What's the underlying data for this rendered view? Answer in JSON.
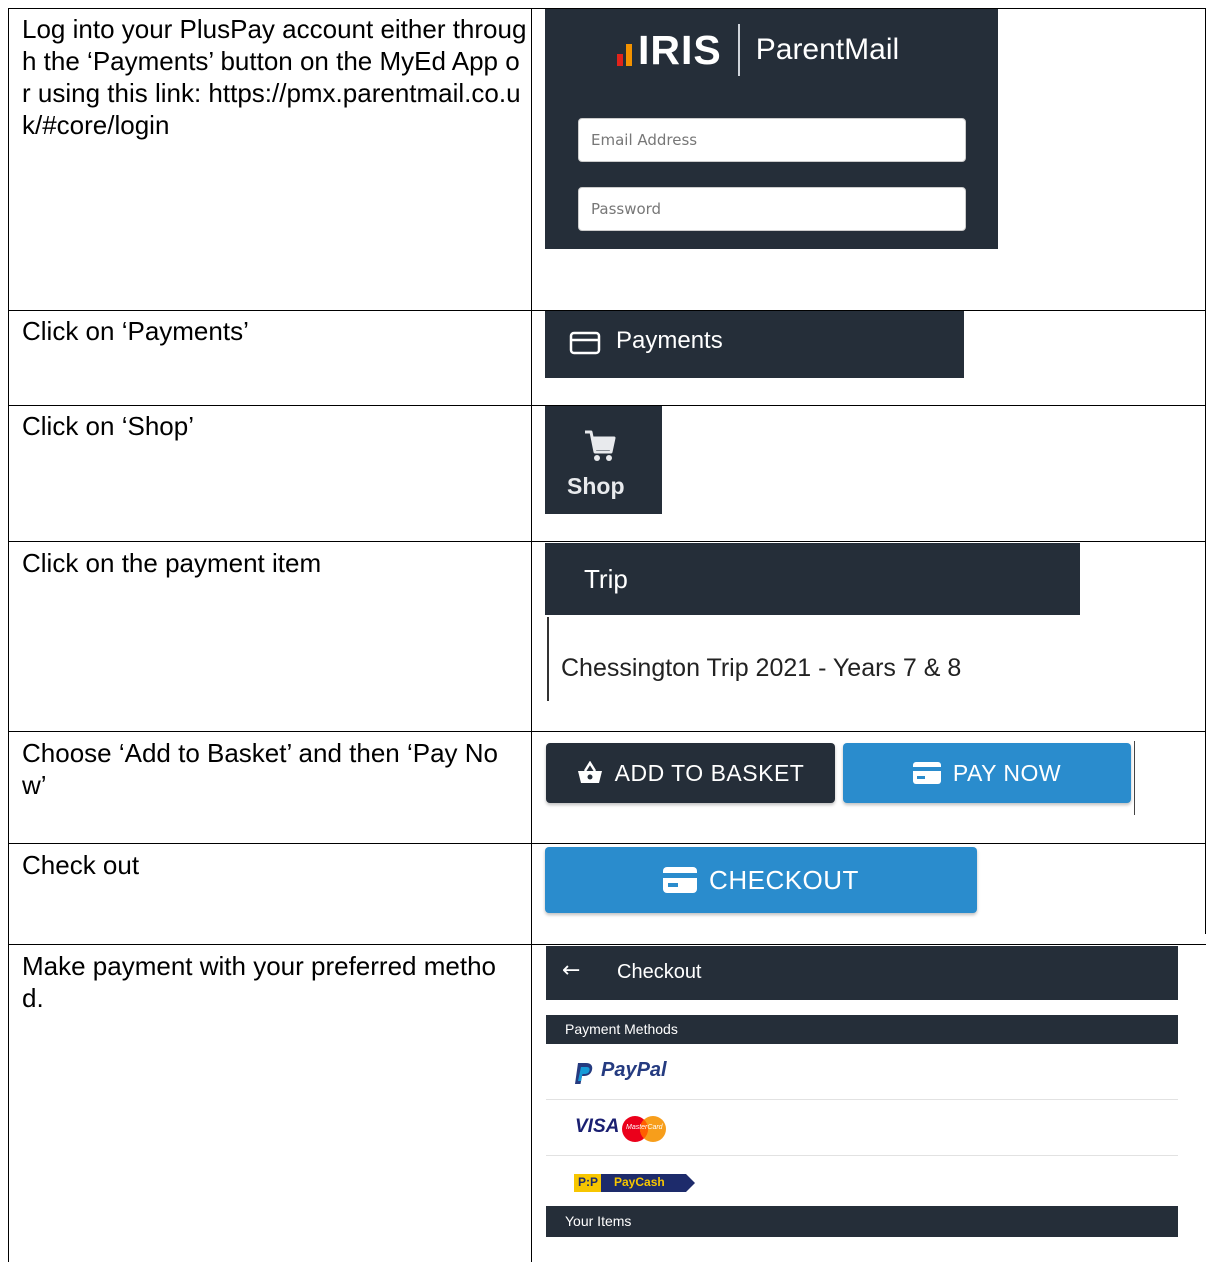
{
  "rows": [
    {
      "description": "Log into your PlusPay account either through the ‘Payments’ button on the MyEd App or using this link: https://pmx.parentmail.co.uk/#core/login"
    },
    {
      "description": "Click on ‘Payments’"
    },
    {
      "description": "Click on ‘Shop’"
    },
    {
      "description": "Click on the payment item"
    },
    {
      "description": "Choose ‘Add to Basket’ and then ‘Pay Now’"
    },
    {
      "description": "Check out"
    },
    {
      "description": "Make payment with your preferred method."
    }
  ],
  "login": {
    "logo_brand": "IRIS",
    "logo_product": "ParentMail",
    "email_placeholder": "Email Address",
    "password_placeholder": "Password"
  },
  "payments_button": {
    "label": "Payments",
    "icon": "card-icon"
  },
  "shop_button": {
    "label": "Shop",
    "icon": "cart-icon"
  },
  "trip": {
    "header": "Trip",
    "item": "Chessington Trip 2021 - Years 7 & 8"
  },
  "buttons": {
    "add_to_basket": "ADD TO BASKET",
    "pay_now": "PAY NOW",
    "checkout": "CHECKOUT"
  },
  "checkout_panel": {
    "back_icon": "←",
    "title": "Checkout",
    "payment_methods_heading": "Payment Methods",
    "methods": [
      {
        "name": "PayPal",
        "logo": "paypal-logo"
      },
      {
        "name": "VISA",
        "logo": "visa-mastercard-logo",
        "secondary": "MasterCard"
      },
      {
        "name": "PayCash",
        "logo": "paycash-logo",
        "badge": "P:P"
      }
    ],
    "your_items_heading": "Your Items"
  },
  "colors": {
    "dark_panel": "#252e39",
    "accent_blue": "#2a8ccd",
    "iris_red": "#e2231a",
    "iris_orange": "#f39200",
    "iris_blue": "#009fe3",
    "paypal_dark": "#253b80",
    "paypal_light": "#179bd7"
  }
}
